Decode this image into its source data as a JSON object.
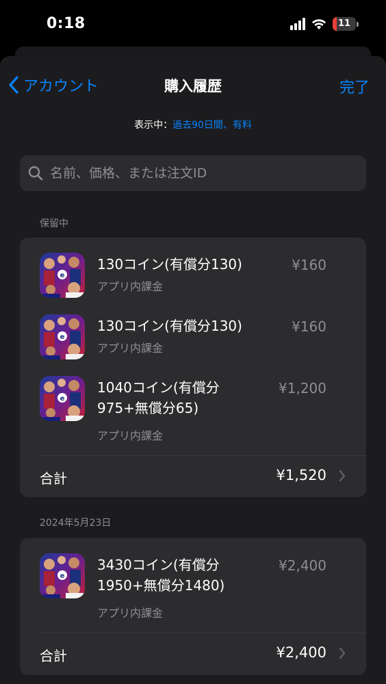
{
  "status_bar": {
    "time": "0:18",
    "battery": "11",
    "battery_level": 0.11,
    "icons": [
      "signal-icon",
      "wifi-icon",
      "battery-icon"
    ]
  },
  "nav": {
    "back_label": "アカウント",
    "title": "購入履歴",
    "done_label": "完了"
  },
  "filter": {
    "prefix": "表示中：",
    "value": "過去90日間、有料"
  },
  "search": {
    "placeholder": "名前、価格、または注文ID"
  },
  "sections": [
    {
      "header": "保留中",
      "items": [
        {
          "name": "130コイン(有償分130)",
          "type": "アプリ内課金",
          "price": "¥160"
        },
        {
          "name": "130コイン(有償分130)",
          "type": "アプリ内課金",
          "price": "¥160"
        },
        {
          "name": "1040コイン(有償分975+無償分65)",
          "type": "アプリ内課金",
          "price": "¥1,200"
        }
      ],
      "total_label": "合計",
      "total": "¥1,520"
    },
    {
      "header": "2024年5月23日",
      "items": [
        {
          "name": "3430コイン(有償分1950+無償分1480)",
          "type": "アプリ内課金",
          "price": "¥2,400"
        }
      ],
      "total_label": "合計",
      "total": "¥2,400"
    }
  ],
  "colors": {
    "accent": "#0a84ff",
    "background": "#000000",
    "sheet": "#1c1c1e",
    "card": "#2c2c2e",
    "secondary_text": "#8e8e93"
  }
}
